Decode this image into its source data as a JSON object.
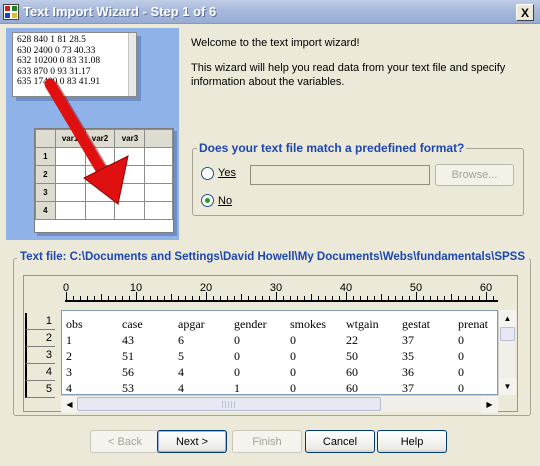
{
  "window": {
    "title": "Text Import Wizard - Step 1 of 6",
    "close_glyph": "X",
    "title_color": "#ffffff"
  },
  "illustration": {
    "text_lines": [
      "628 840 1 81 28.5",
      "630 2400 0 73 40.33",
      "632 10200 0 83 31.08",
      "633 870 0 93 31.17",
      "635 17400 0 83 41.91"
    ],
    "columns": [
      "var1",
      "var2",
      "var3"
    ],
    "rows": [
      "1",
      "2",
      "3",
      "4"
    ],
    "arrow_color": "#e01010",
    "background_color": "#8fb3e8"
  },
  "welcome": {
    "heading": "Welcome to the text import wizard!",
    "description": "This wizard will help you read data from your text file and specify information about the variables."
  },
  "format_group": {
    "legend": "Does your text file match a predefined format?",
    "yes_label": "Yes",
    "no_label": "No",
    "selected": "No",
    "file_value": "",
    "browse_label": "Browse..."
  },
  "text_file": {
    "legend": "Text file:  C:\\Documents and Settings\\David Howell\\My Documents\\Webs\\fundamentals\\SPSS",
    "ruler_labels": [
      "0",
      "10",
      "20",
      "30",
      "40",
      "50",
      "60"
    ],
    "row_numbers": [
      "1",
      "2",
      "3",
      "4",
      "5"
    ],
    "columns": [
      "obs",
      "case",
      "apgar",
      "gender",
      "smokes",
      "wtgain",
      "gestat",
      "prenat"
    ],
    "rows": [
      [
        "obs",
        "case",
        "apgar",
        "gender",
        "smokes",
        "wtgain",
        "gestat",
        "prenat"
      ],
      [
        "1",
        "43",
        "6",
        "0",
        "0",
        "22",
        "37",
        "0"
      ],
      [
        "2",
        "51",
        "5",
        "0",
        "0",
        "50",
        "35",
        "0"
      ],
      [
        "3",
        "56",
        "4",
        "0",
        "0",
        "60",
        "36",
        "0"
      ],
      [
        "4",
        "53",
        "4",
        "1",
        "0",
        "60",
        "37",
        "0"
      ]
    ]
  },
  "buttons": {
    "back": "< Back",
    "next": "Next >",
    "finish": "Finish",
    "cancel": "Cancel",
    "help": "Help"
  }
}
